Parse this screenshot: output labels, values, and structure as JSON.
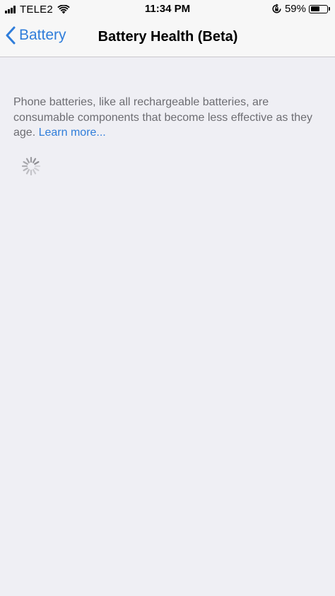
{
  "status_bar": {
    "carrier": "TELE2",
    "time": "11:34 PM",
    "battery_percent": "59%",
    "battery_level": 0.59,
    "icons": [
      "signal-bars-icon",
      "wifi-icon",
      "orientation-lock-icon",
      "battery-icon"
    ]
  },
  "nav": {
    "back_label": "Battery",
    "title": "Battery Health (Beta)"
  },
  "content": {
    "description": "Phone batteries, like all rechargeable batteries, are consumable components that become less effective as they age.",
    "learn_more": "Learn more..."
  },
  "colors": {
    "accent": "#2f7dda",
    "background": "#efeff4",
    "bar_background": "#f7f7f7",
    "secondary_text": "#6d6d72"
  }
}
